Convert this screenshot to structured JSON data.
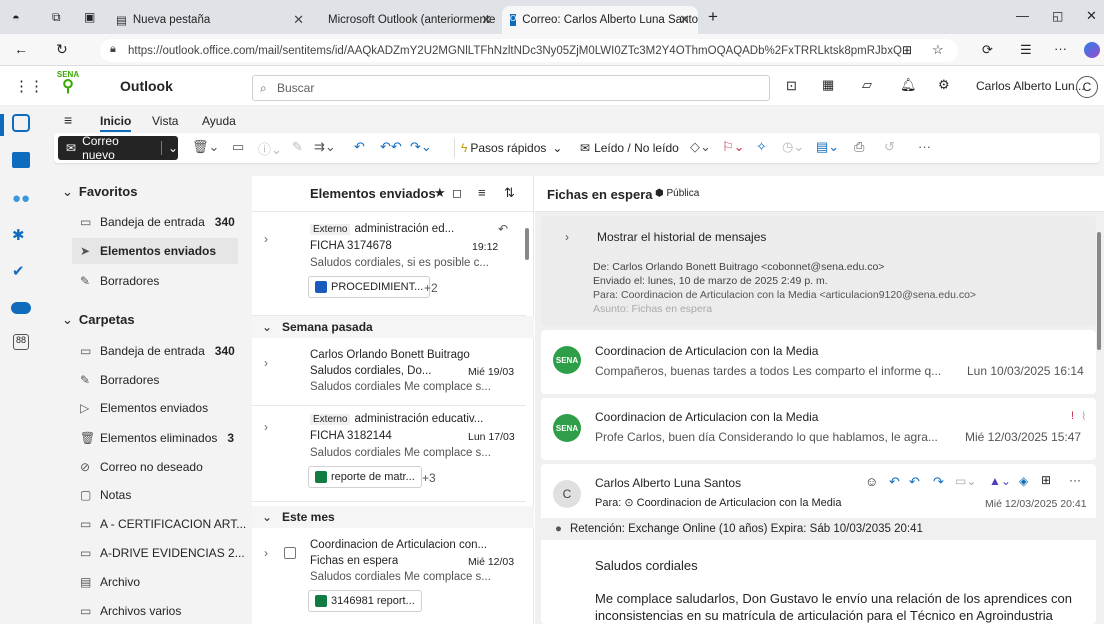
{
  "browser": {
    "tabs": [
      {
        "label": "Nueva pestaña"
      },
      {
        "label": "Microsoft Outlook (anteriormente"
      },
      {
        "label": "Correo: Carlos Alberto Luna Santo"
      }
    ],
    "url": "https://outlook.office.com/mail/sentitems/id/AAQkADZmY2U2MGNlLTFhNzltNDc3Ny05ZjM0LWI0ZTc3M2Y4OThmOQAQADb%2FxTRRLktsk8pmRJbxQ..."
  },
  "header": {
    "app_name": "Outlook",
    "logo_text": "SENA",
    "search_placeholder": "Buscar",
    "user_name": "Carlos Alberto Lun...",
    "user_initial": "C"
  },
  "ribbon": {
    "tabs": [
      "Inicio",
      "Vista",
      "Ayuda"
    ],
    "new_mail": "Correo nuevo",
    "quick_steps": "Pasos rápidos",
    "read_unread": "Leído / No leído",
    "more": "···"
  },
  "folders": {
    "favorites_label": "Favoritos",
    "favorites": [
      {
        "label": "Bandeja de entrada",
        "count": "340"
      },
      {
        "label": "Elementos enviados",
        "count": ""
      },
      {
        "label": "Borradores",
        "count": ""
      }
    ],
    "folders_label": "Carpetas",
    "items": [
      {
        "label": "Bandeja de entrada",
        "count": "340"
      },
      {
        "label": "Borradores",
        "count": ""
      },
      {
        "label": "Elementos enviados",
        "count": ""
      },
      {
        "label": "Elementos eliminados",
        "count": "3"
      },
      {
        "label": "Correo no deseado",
        "count": ""
      },
      {
        "label": "Notas",
        "count": ""
      },
      {
        "label": "A - CERTIFICACION ART...",
        "count": ""
      },
      {
        "label": "A-DRIVE EVIDENCIAS 2...",
        "count": ""
      },
      {
        "label": "Archivo",
        "count": ""
      },
      {
        "label": "Archivos varios",
        "count": ""
      }
    ]
  },
  "list": {
    "title": "Elementos enviados",
    "groups": [
      "Semana pasada",
      "Este mes"
    ],
    "messages": [
      {
        "tag": "Externo",
        "from": "administración ed...",
        "subject": "FICHA 3174678",
        "time": "19:12",
        "preview": "Saludos cordiales, si es posible c...",
        "attachment": "PROCEDIMIENT...",
        "extra": "+2"
      },
      {
        "tag": "",
        "from": "Carlos Orlando Bonett Buitrago",
        "subject": "Saludos cordiales, Do...",
        "time": "Mié 19/03",
        "preview": "Saludos cordiales Me complace s...",
        "attachment": "",
        "extra": ""
      },
      {
        "tag": "Externo",
        "from": "administración educativ...",
        "subject": "FICHA 3182144",
        "time": "Lun 17/03",
        "preview": "Saludos cordiales Me complace s...",
        "attachment": "reporte de matr...",
        "extra": "+3"
      },
      {
        "tag": "",
        "from": "Coordinacion de Articulacion con...",
        "subject": "Fichas en espera",
        "time": "Mié 12/03",
        "preview": "Saludos cordiales Me complace s...",
        "attachment": "3146981 report...",
        "extra": ""
      }
    ]
  },
  "reading": {
    "subject": "Fichas en espera",
    "visibility": "Pública",
    "history": "Mostrar el historial de mensajes",
    "quoted": {
      "from": "De: Carlos Orlando Bonett Buitrago <cobonnet@sena.edu.co>",
      "sent": "Enviado el: lunes, 10 de marzo de 2025 2:49 p. m.",
      "to": "Para: Coordinacion de Articulacion con la Media <articulacion9120@sena.edu.co>",
      "subject": "Asunto: Fichas en espera"
    },
    "thread": [
      {
        "from": "Coordinacion de Articulacion con la Media",
        "preview": "Compañeros, buenas tardes a todos Les comparto el informe q...",
        "date": "Lun 10/03/2025 16:14"
      },
      {
        "from": "Coordinacion de Articulacion con la Media",
        "preview": "Profe Carlos, buen día Considerando lo que hablamos, le agra...",
        "date": "Mié 12/03/2025 15:47"
      }
    ],
    "open": {
      "from": "Carlos Alberto Luna Santos",
      "to": "Para: ⊙ Coordinacion de Articulacion con la Media",
      "date": "Mié 12/03/2025 20:41",
      "retention": "Retención: Exchange Online (10 años) Expira: Sáb 10/03/2035 20:41",
      "greeting": "Saludos cordiales",
      "body": "Me complace saludarlos, Don Gustavo le envío una relación de los aprendices con inconsistencias en su matrícula de articulación para el Técnico en Agroindustria"
    }
  },
  "colors": {
    "accent": "#0f6cbd",
    "sena_green": "#39a900"
  }
}
